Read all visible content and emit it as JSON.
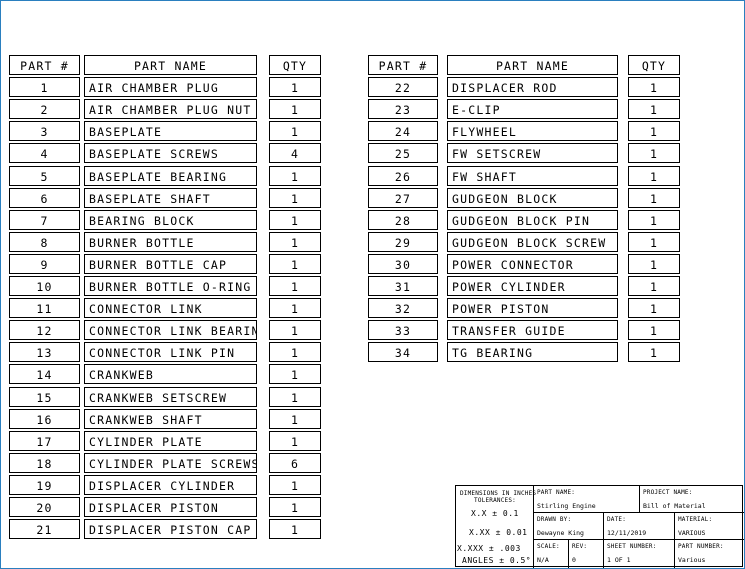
{
  "table_left": {
    "headers": {
      "part": "PART #",
      "name": "PART NAME",
      "qty": "QTY"
    },
    "rows": [
      {
        "part": "1",
        "name": "AIR CHAMBER PLUG",
        "qty": "1"
      },
      {
        "part": "2",
        "name": "AIR CHAMBER PLUG NUT",
        "qty": "1"
      },
      {
        "part": "3",
        "name": "BASEPLATE",
        "qty": "1"
      },
      {
        "part": "4",
        "name": "BASEPLATE SCREWS",
        "qty": "4"
      },
      {
        "part": "5",
        "name": "BASEPLATE BEARING",
        "qty": "1"
      },
      {
        "part": "6",
        "name": "BASEPLATE SHAFT",
        "qty": "1"
      },
      {
        "part": "7",
        "name": "BEARING BLOCK",
        "qty": "1"
      },
      {
        "part": "8",
        "name": "BURNER BOTTLE",
        "qty": "1"
      },
      {
        "part": "9",
        "name": "BURNER BOTTLE CAP",
        "qty": "1"
      },
      {
        "part": "10",
        "name": "BURNER BOTTLE O-RING",
        "qty": "1"
      },
      {
        "part": "11",
        "name": "CONNECTOR LINK",
        "qty": "1"
      },
      {
        "part": "12",
        "name": "CONNECTOR LINK BEARING",
        "qty": "1"
      },
      {
        "part": "13",
        "name": "CONNECTOR LINK PIN",
        "qty": "1"
      },
      {
        "part": "14",
        "name": "CRANKWEB",
        "qty": "1"
      },
      {
        "part": "15",
        "name": "CRANKWEB SETSCREW",
        "qty": "1"
      },
      {
        "part": "16",
        "name": "CRANKWEB SHAFT",
        "qty": "1"
      },
      {
        "part": "17",
        "name": "CYLINDER PLATE",
        "qty": "1"
      },
      {
        "part": "18",
        "name": "CYLINDER PLATE SCREWS",
        "qty": "6"
      },
      {
        "part": "19",
        "name": "DISPLACER CYLINDER",
        "qty": "1"
      },
      {
        "part": "20",
        "name": "DISPLACER PISTON",
        "qty": "1"
      },
      {
        "part": "21",
        "name": "DISPLACER PISTON CAP",
        "qty": "1"
      }
    ]
  },
  "table_right": {
    "headers": {
      "part": "PART #",
      "name": "PART NAME",
      "qty": "QTY"
    },
    "rows": [
      {
        "part": "22",
        "name": "DISPLACER ROD",
        "qty": "1"
      },
      {
        "part": "23",
        "name": "E-CLIP",
        "qty": "1"
      },
      {
        "part": "24",
        "name": "FLYWHEEL",
        "qty": "1"
      },
      {
        "part": "25",
        "name": "FW SETSCREW",
        "qty": "1"
      },
      {
        "part": "26",
        "name": "FW SHAFT",
        "qty": "1"
      },
      {
        "part": "27",
        "name": "GUDGEON BLOCK",
        "qty": "1"
      },
      {
        "part": "28",
        "name": "GUDGEON BLOCK PIN",
        "qty": "1"
      },
      {
        "part": "29",
        "name": "GUDGEON BLOCK SCREW",
        "qty": "1"
      },
      {
        "part": "30",
        "name": "POWER CONNECTOR",
        "qty": "1"
      },
      {
        "part": "31",
        "name": "POWER CYLINDER",
        "qty": "1"
      },
      {
        "part": "32",
        "name": "POWER PISTON",
        "qty": "1"
      },
      {
        "part": "33",
        "name": "TRANSFER GUIDE",
        "qty": "1"
      },
      {
        "part": "34",
        "name": "TG BEARING",
        "qty": "1"
      }
    ]
  },
  "title_block": {
    "tolerances_heading_1": "DIMENSIONS IN INCHES",
    "tolerances_heading_2": "TOLERANCES:",
    "tol_x_x": "X.X ± 0.1",
    "tol_x_xx": "X.XX ± 0.01",
    "tol_x_xxx": "X.XXX  ± .003",
    "tol_angles": "ANGLES ± 0.5°",
    "part_name_label": "PART NAME:",
    "part_name_value": "Stirling Engine",
    "project_name_label": "PROJECT NAME:",
    "project_name_value": "Bill of Material",
    "drawn_by_label": "DRAWN BY:",
    "drawn_by_value": "Dewayne King",
    "date_label": "DATE:",
    "date_value": "12/11/2019",
    "material_label": "MATERIAL:",
    "material_value": "VARIOUS",
    "scale_label": "SCALE:",
    "scale_value": "N/A",
    "rev_label": "REV:",
    "rev_value": "0",
    "sheet_number_label": "SHEET NUMBER:",
    "sheet_number_value": "1 OF 1",
    "part_number_label": "PART NUMBER:",
    "part_number_value": "Various"
  }
}
